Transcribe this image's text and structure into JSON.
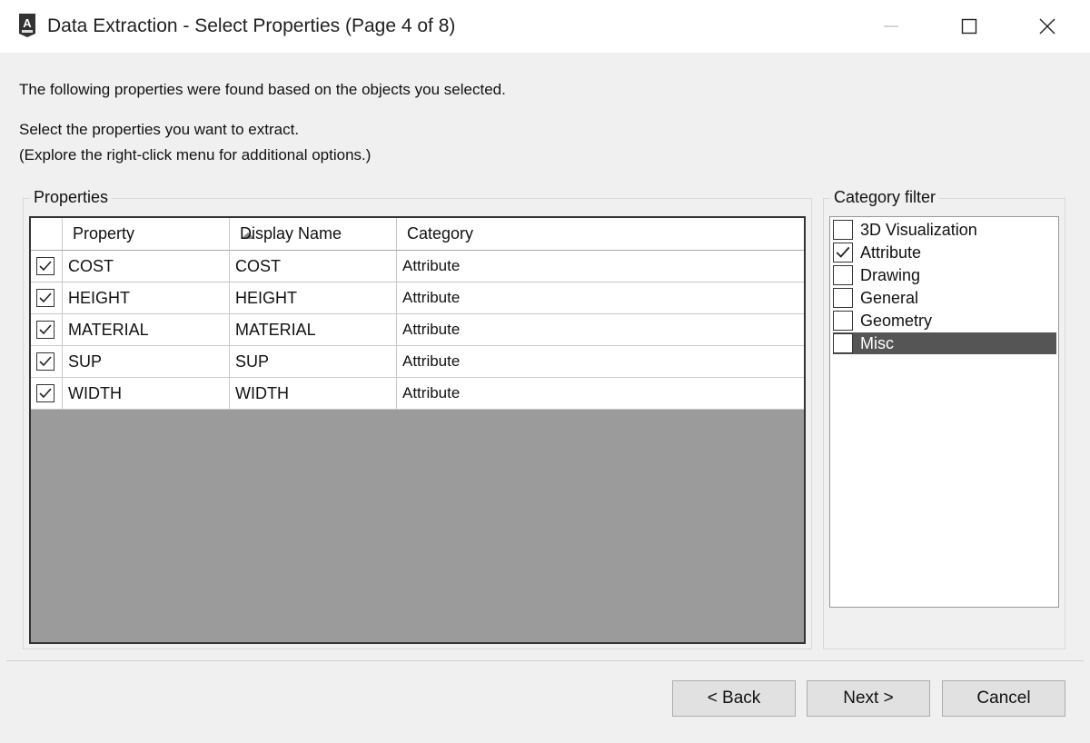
{
  "window": {
    "title": "Data Extraction - Select Properties (Page 4 of 8)",
    "icon": "autocad-app-icon"
  },
  "instructions": {
    "line1": "The following properties were found based on the objects you selected.",
    "line2": "Select the properties you want to extract.",
    "line3": "(Explore the right-click menu for additional options.)"
  },
  "properties": {
    "group_label": "Properties",
    "columns": [
      "Property",
      "Display Name",
      "Category"
    ],
    "sort_column": "Property",
    "rows": [
      {
        "checked": true,
        "property": "COST",
        "display_name": "COST",
        "category": "Attribute"
      },
      {
        "checked": true,
        "property": "HEIGHT",
        "display_name": "HEIGHT",
        "category": "Attribute"
      },
      {
        "checked": true,
        "property": "MATERIAL",
        "display_name": "MATERIAL",
        "category": "Attribute"
      },
      {
        "checked": true,
        "property": "SUP",
        "display_name": "SUP",
        "category": "Attribute"
      },
      {
        "checked": true,
        "property": "WIDTH",
        "display_name": "WIDTH",
        "category": "Attribute"
      }
    ]
  },
  "category_filter": {
    "group_label": "Category filter",
    "items": [
      {
        "label": "3D Visualization",
        "checked": false,
        "selected": false
      },
      {
        "label": "Attribute",
        "checked": true,
        "selected": false
      },
      {
        "label": "Drawing",
        "checked": false,
        "selected": false
      },
      {
        "label": "General",
        "checked": false,
        "selected": false
      },
      {
        "label": "Geometry",
        "checked": false,
        "selected": false
      },
      {
        "label": "Misc",
        "checked": false,
        "selected": true
      }
    ]
  },
  "buttons": {
    "back": "< Back",
    "next": "Next >",
    "cancel": "Cancel"
  }
}
